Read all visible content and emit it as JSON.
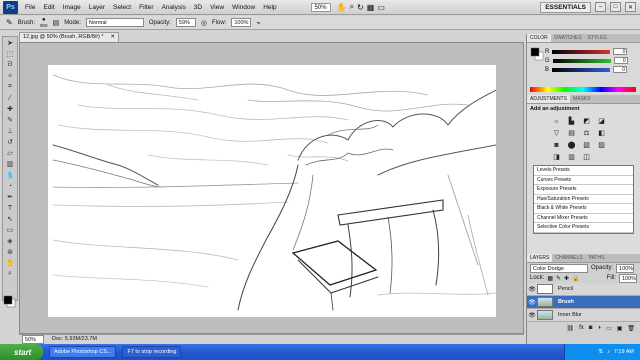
{
  "app": {
    "logo": "Ps"
  },
  "menu": [
    "File",
    "Edit",
    "Image",
    "Layer",
    "Select",
    "Filter",
    "Analysis",
    "3D",
    "View",
    "Window",
    "Help"
  ],
  "menubar_right": {
    "zoom": "50%",
    "workspace": "ESSENTIALS"
  },
  "options": {
    "brush_label": "Brush:",
    "brush_size": "900",
    "mode_label": "Mode:",
    "mode_value": "Normal",
    "opacity_label": "Opacity:",
    "opacity_value": "59%",
    "flow_label": "Flow:",
    "flow_value": "100%"
  },
  "document": {
    "tab_title": "12.jpg @ 50% (Brush, RGB/8#) *",
    "zoom": "50%",
    "doc_info": "Doc: 5.93M/23.7M"
  },
  "color_panel": {
    "tabs": [
      "COLOR",
      "SWATCHES",
      "STYLES"
    ],
    "channels": [
      {
        "label": "R",
        "value": "0",
        "color": "#e03030"
      },
      {
        "label": "G",
        "value": "0",
        "color": "#30c030"
      },
      {
        "label": "B",
        "value": "0",
        "color": "#3060e0"
      }
    ]
  },
  "adjustments_panel": {
    "tabs": [
      "ADJUSTMENTS",
      "MASKS"
    ],
    "heading": "Add an adjustment",
    "icons": [
      "brightness-icon",
      "levels-icon",
      "curves-icon",
      "exposure-icon",
      "vibrance-icon",
      "hue-saturation-icon",
      "color-balance-icon",
      "black-white-icon",
      "photo-filter-icon",
      "channel-mixer-icon",
      "invert-icon",
      "posterize-icon",
      "threshold-icon",
      "gradient-map-icon",
      "selective-color-icon"
    ],
    "presets": [
      "Levels Presets",
      "Curves Presets",
      "Exposure Presets",
      "Hue/Saturation Presets",
      "Black & White Presets",
      "Channel Mixer Presets",
      "Selective Color Presets"
    ]
  },
  "layers_panel": {
    "tabs": [
      "LAYERS",
      "CHANNELS",
      "PATHS"
    ],
    "blend_mode": "Color Dodge",
    "opacity_label": "Opacity:",
    "opacity_value": "100%",
    "lock_label": "Lock:",
    "fill_label": "Fill:",
    "fill_value": "100%",
    "layers": [
      {
        "name": "Pencil",
        "active": false
      },
      {
        "name": "Brush",
        "active": true
      },
      {
        "name": "Inner Blur",
        "active": false
      }
    ]
  },
  "taskbar": {
    "start": "start",
    "tasks": [
      "Adobe Photoshop CS...",
      "F7 to stop recording"
    ],
    "time": "7:19 AM"
  }
}
